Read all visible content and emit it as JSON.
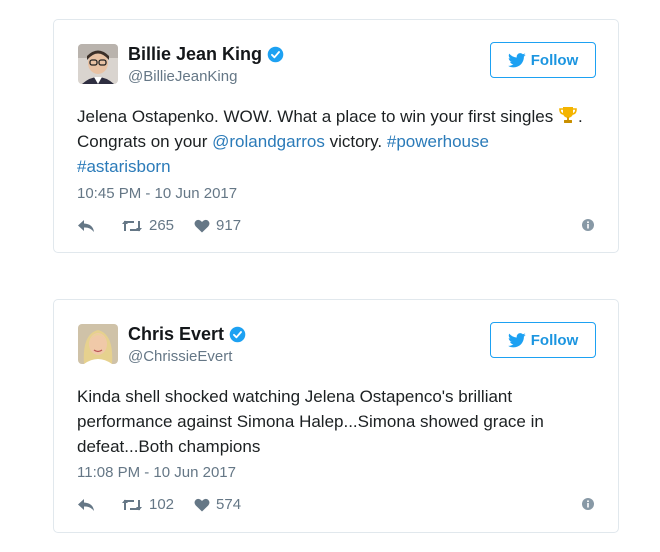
{
  "tweets": [
    {
      "name": "Billie Jean King",
      "handle": "@BillieJeanKing",
      "follow_label": "Follow",
      "text_part1": "Jelena Ostapenko. WOW. What a place to win your first singles ",
      "text_part2": ". Congrats on your ",
      "mention": "@rolandgarros",
      "text_part3": " victory. ",
      "hashtag1": "#powerhouse",
      "hashtag2": "#astarisborn",
      "timestamp": "10:45 PM - 10 Jun 2017",
      "retweets": "265",
      "likes": "917"
    },
    {
      "name": "Chris Evert",
      "handle": "@ChrissieEvert",
      "follow_label": "Follow",
      "text": "Kinda shell shocked watching Jelena Ostapenco's brilliant performance against Simona Halep...Simona showed grace in defeat...Both champions",
      "timestamp": "11:08 PM - 10 Jun 2017",
      "retweets": "102",
      "likes": "574"
    }
  ],
  "colors": {
    "accent": "#1da1f2",
    "link": "#2b7bb9",
    "muted": "#657786",
    "border": "#e1e8ed"
  }
}
